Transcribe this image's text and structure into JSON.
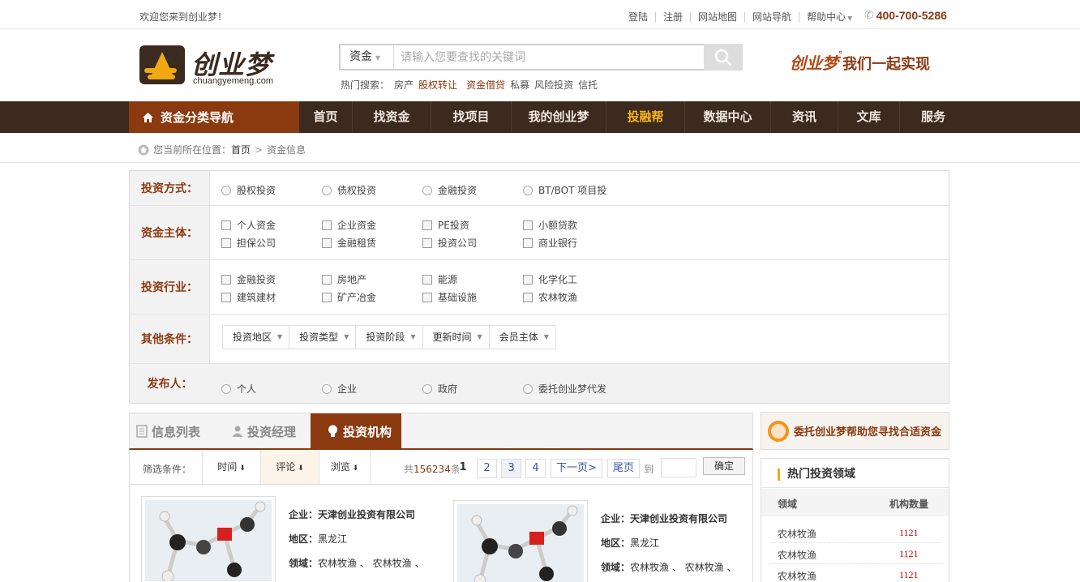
{
  "topbar": {
    "welcome": "欢迎您来到创业梦！",
    "links": [
      "登陆",
      "注册",
      "网站地图",
      "网站导航",
      "帮助中心"
    ],
    "phone": "400-700-5286"
  },
  "header": {
    "logo_cn": "创业梦",
    "logo_en": "chuangyemeng.com",
    "search_type": "资金",
    "search_placeholder": "请输入您要查找的关键词",
    "hot_label": "热门搜索：",
    "hot_terms": [
      "房产",
      "股权转让",
      "资金借贷",
      "私募",
      "风险投资",
      "信托"
    ],
    "slogan_brand": "创业梦",
    "slogan_text": "我们一起实现"
  },
  "nav": {
    "category": "资金分类导航",
    "items": [
      "首页",
      "找资金",
      "找项目",
      "我的创业梦",
      "投融帮",
      "数据中心",
      "资讯",
      "文库",
      "服务"
    ],
    "active_index": 4
  },
  "breadcrumb": {
    "prefix": "您当前所在位置：",
    "home": "首页",
    "current": "资金信息"
  },
  "filters": {
    "method": {
      "label": "投资方式：",
      "options": [
        "股权投资",
        "债权投资",
        "金融投资",
        "BT/BOT 项目投"
      ]
    },
    "subject": {
      "label": "资金主体：",
      "options": [
        "个人资金",
        "企业资金",
        "PE投资",
        "小额贷款",
        "担保公司",
        "金融租赁",
        "投资公司",
        "商业银行"
      ]
    },
    "industry": {
      "label": "投资行业：",
      "options": [
        "金融投资",
        "房地产",
        "能源",
        "化学化工",
        "建筑建材",
        "矿产冶金",
        "基础设施",
        "农林牧渔"
      ]
    },
    "other": {
      "label": "其他条件：",
      "dropdowns": [
        "投资地区",
        "投资类型",
        "投资阶段",
        "更新时间",
        "会员主体"
      ]
    },
    "publisher": {
      "label": "发布人：",
      "options": [
        "个人",
        "企业",
        "政府",
        "委托创业梦代发"
      ]
    }
  },
  "tabs": [
    "信息列表",
    "投资经理",
    "投资机构"
  ],
  "active_tab": 2,
  "sortbar": {
    "label": "筛选条件：",
    "buttons": [
      "时间",
      "评论",
      "浏览"
    ],
    "total_prefix": "共",
    "total": "156234",
    "total_suffix": "条",
    "pages": [
      "1",
      "2",
      "3",
      "4"
    ],
    "next": "下一页>",
    "last": "尾页",
    "goto": "到",
    "confirm": "确定"
  },
  "cards": [
    {
      "company_label": "企业：",
      "company": "天津创业投资有限公司",
      "region_label": "地区：",
      "region": "黑龙江",
      "field_label": "领域：",
      "field": "农林牧渔 、 农林牧渔 、"
    },
    {
      "company_label": "企业：",
      "company": "天津创业投资有限公司",
      "region_label": "地区：",
      "region": "黑龙江",
      "field_label": "领域：",
      "field": "农林牧渔 、 农林牧渔 、"
    }
  ],
  "sidebar": {
    "entrust": "委托创业梦帮助您寻找合适资金",
    "hot_title": "热门投资领域",
    "col_field": "领域",
    "col_count": "机构数量",
    "rows": [
      {
        "field": "农林牧渔",
        "count": "1121"
      },
      {
        "field": "农林牧渔",
        "count": "1121"
      },
      {
        "field": "农林牧渔",
        "count": "1121"
      }
    ]
  }
}
